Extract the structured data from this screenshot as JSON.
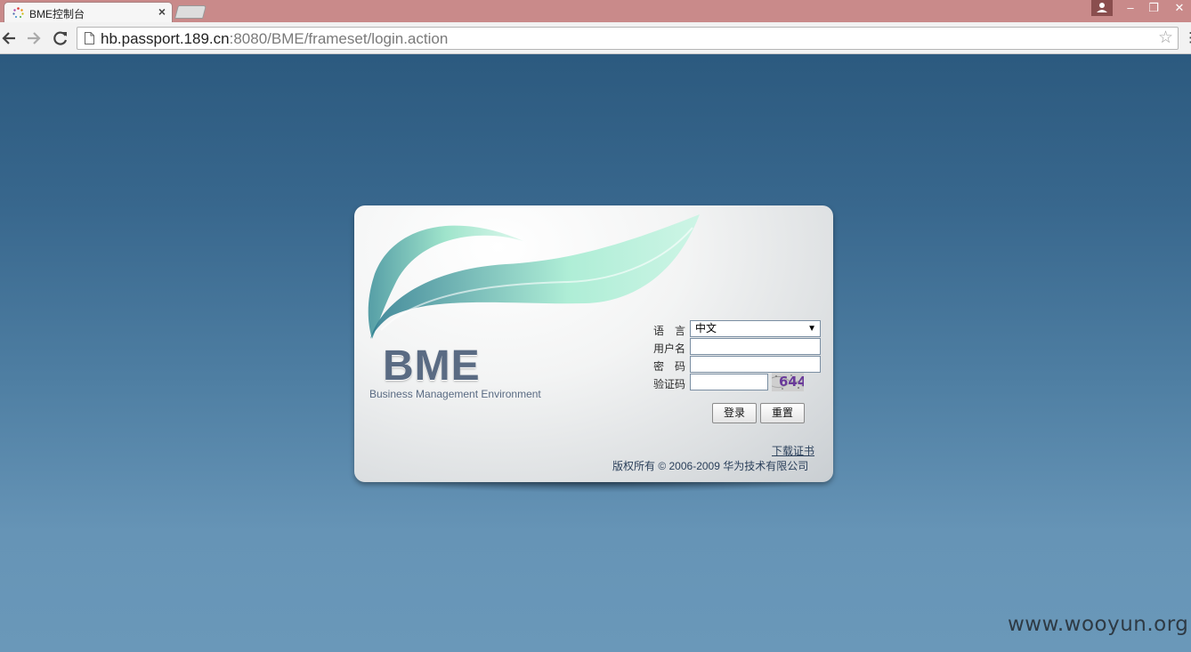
{
  "browser": {
    "tab_title": "BME控制台",
    "tab_close": "×",
    "url_host": "hb.passport.189.cn",
    "url_rest": ":8080/BME/frameset/login.action",
    "star_icon": "☆",
    "menu_icon": "⋮",
    "window_buttons": {
      "minimize": "–",
      "restore": "❐",
      "close": "✕"
    }
  },
  "logo": {
    "title": "BME",
    "subtitle": "Business Management Environment"
  },
  "form": {
    "language_label": "语　言",
    "language_value": "中文",
    "username_label": "用户名",
    "username_value": "",
    "password_label": "密　码",
    "password_value": "",
    "captcha_label": "验证码",
    "captcha_value": "",
    "captcha_image_text": "644",
    "login_button": "登录",
    "reset_button": "重置"
  },
  "footer": {
    "download_cert": "下载证书",
    "copyright": "版权所有 © 2006-2009 华为技术有限公司"
  },
  "watermark": "www.wooyun.org",
  "colors": {
    "tabstrip": "#c98a8a",
    "page_top": "#2c5a7f",
    "page_bottom": "#6a98b9",
    "logo": "#5a6b83",
    "leaf": "#7fd6b8"
  }
}
